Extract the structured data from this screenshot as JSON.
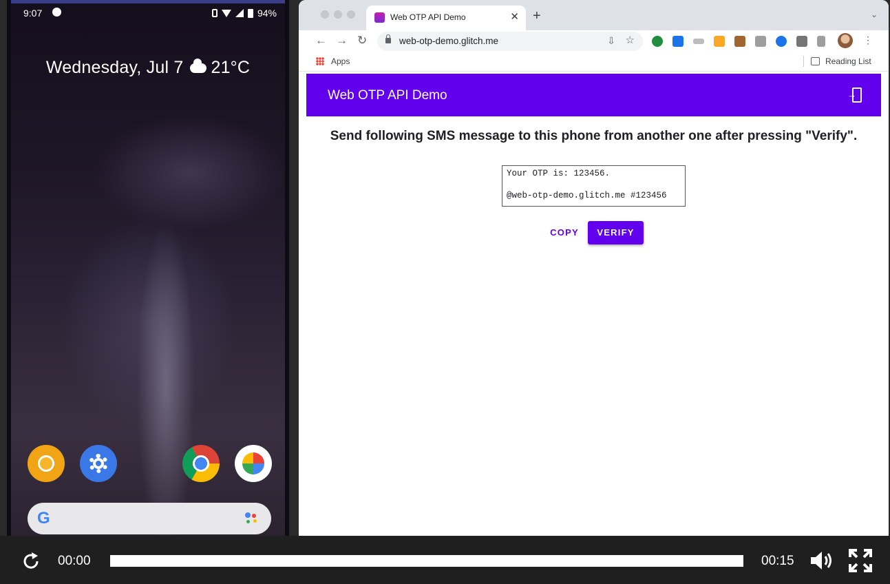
{
  "phone": {
    "status_time": "9:07",
    "battery": "94%",
    "date_line": "Wednesday, Jul 7",
    "temperature": "21°C",
    "apps": [
      "chrome-beta",
      "settings",
      "chrome",
      "google-photos"
    ],
    "search_logo": "G"
  },
  "browser": {
    "tab_title": "Web OTP API Demo",
    "url": "web-otp-demo.glitch.me",
    "bookmark_apps": "Apps",
    "reading_list": "Reading List"
  },
  "page": {
    "app_title": "Web OTP API Demo",
    "instruction": "Send following SMS message to this phone from another one after pressing \"Verify\".",
    "sms_text": "Your OTP is: 123456.\n\n@web-otp-demo.glitch.me #123456",
    "copy_label": "COPY",
    "verify_label": "VERIFY",
    "accent_color": "#6200ee"
  },
  "player": {
    "current_time": "00:00",
    "total_time": "00:15",
    "progress_fraction": 0
  }
}
